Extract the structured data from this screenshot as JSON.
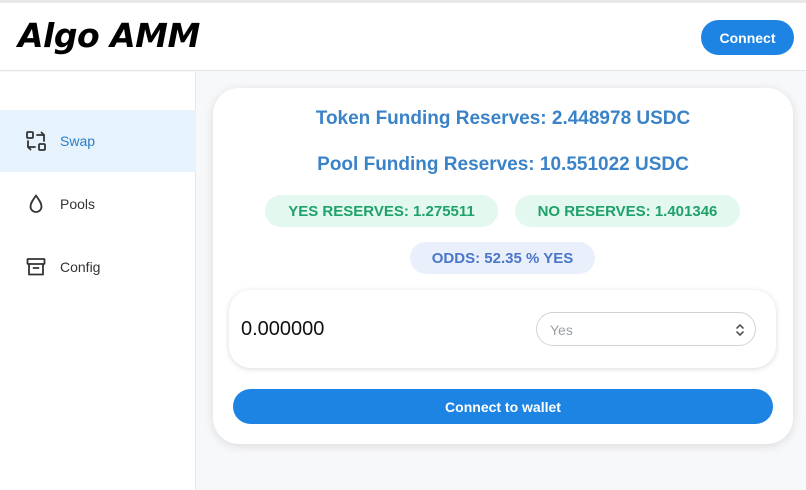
{
  "header": {
    "logo": "Algo AMM",
    "connect_label": "Connect"
  },
  "sidebar": {
    "items": [
      {
        "label": "Swap",
        "icon": "swap-icon",
        "active": true
      },
      {
        "label": "Pools",
        "icon": "droplet-icon",
        "active": false
      },
      {
        "label": "Config",
        "icon": "archive-icon",
        "active": false
      }
    ]
  },
  "main": {
    "token_funding": "Token Funding Reserves: 2.448978 USDC",
    "pool_funding": "Pool Funding Reserves: 10.551022 USDC",
    "yes_reserves": "YES RESERVES: 1.275511",
    "no_reserves": "NO RESERVES: 1.401346",
    "odds": "ODDS: 52.35 % YES",
    "swap": {
      "amount": "0.000000",
      "selected_option": "Yes"
    },
    "wallet_button": "Connect to wallet"
  },
  "colors": {
    "accent": "#1e84e4",
    "heading": "#3b83c8",
    "green_text": "#1fa16a",
    "green_bg": "#e3f8ef",
    "blue_text": "#4a76c9",
    "blue_bg": "#eaf0fb",
    "active_bg": "#e6f3fc"
  }
}
